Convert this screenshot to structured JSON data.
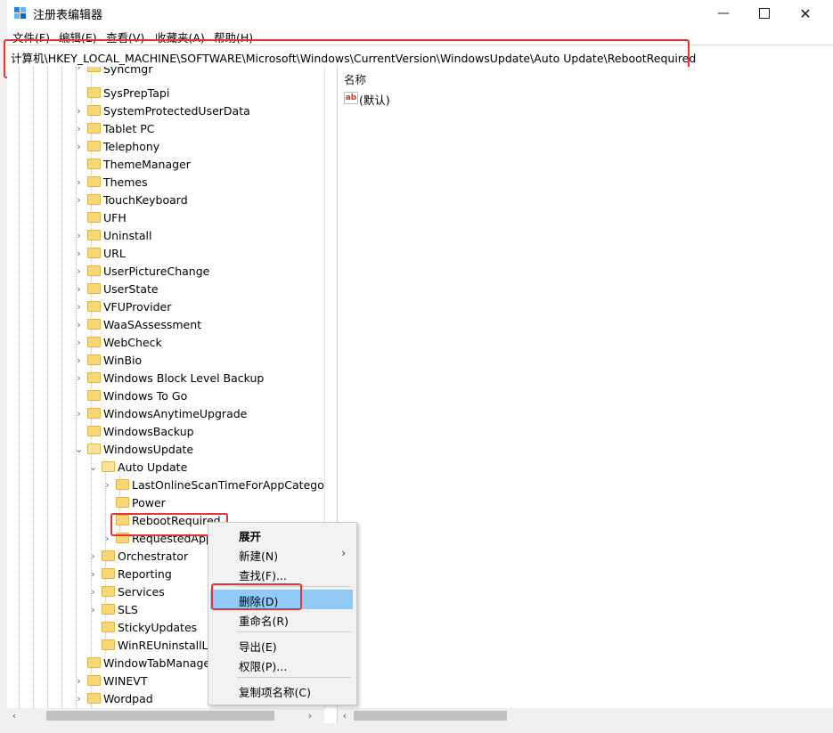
{
  "window": {
    "title": "注册表编辑器",
    "controls": {
      "minimize": "—",
      "maximize": "",
      "close": "✕"
    }
  },
  "menu": [
    "文件(F)",
    "编辑(E)",
    "查看(V)",
    "收藏夹(A)",
    "帮助(H)"
  ],
  "address_path": "计算机\\HKEY_LOCAL_MACHINE\\SOFTWARE\\Microsoft\\Windows\\CurrentVersion\\WindowsUpdate\\Auto Update\\RebootRequired",
  "tree": {
    "partial_top_label": "Syncmgr",
    "level1": [
      "SysPrepTapi",
      "SystemProtectedUserData",
      "Tablet PC",
      "Telephony",
      "ThemeManager",
      "Themes",
      "TouchKeyboard",
      "UFH",
      "Uninstall",
      "URL",
      "UserPictureChange",
      "UserState",
      "VFUProvider",
      "WaaSAssessment",
      "WebCheck",
      "WinBio",
      "Windows Block Level Backup",
      "Windows To Go",
      "WindowsAnytimeUpgrade",
      "WindowsBackup"
    ],
    "expanded_node": "WindowsUpdate",
    "auto_update": "Auto Update",
    "auto_update_children": [
      "LastOnlineScanTimeForAppCategory",
      "Power",
      "RebootRequired",
      "RequestedApp"
    ],
    "selected_key": "RebootRequired",
    "windowsupdate_children": [
      "Orchestrator",
      "Reporting",
      "Services",
      "SLS",
      "StickyUpdates",
      "WinREUninstallList"
    ],
    "after": [
      "WindowTabManager",
      "WINEVT",
      "Wordpad"
    ]
  },
  "values_pane": {
    "column_name": "名称",
    "default_value_icon": "ab",
    "default_value_name": "(默认)"
  },
  "context_menu": {
    "items": [
      {
        "label": "展开",
        "bold": true
      },
      {
        "label": "新建(N)",
        "submenu": true
      },
      {
        "label": "查找(F)..."
      },
      {
        "label": "删除(D)",
        "highlighted": true
      },
      {
        "label": "重命名(R)"
      },
      {
        "label": "导出(E)"
      },
      {
        "label": "权限(P)..."
      },
      {
        "label": "复制项名称(C)"
      }
    ]
  },
  "colors": {
    "highlight_box": "#e83434",
    "menu_active": "#91c9f7",
    "folder": "#f8d775"
  }
}
